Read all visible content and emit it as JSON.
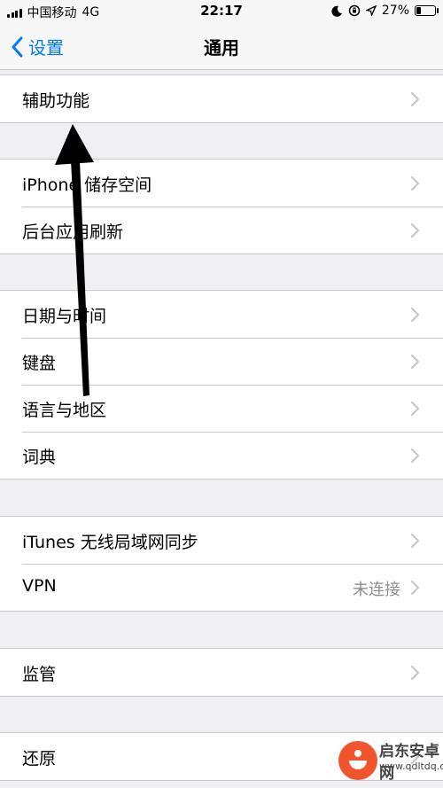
{
  "status_bar": {
    "carrier": "中国移动",
    "network": "4G",
    "time": "22:17",
    "battery": "27%",
    "battery_level": 0.27
  },
  "nav": {
    "back_label": "设置",
    "title": "通用"
  },
  "groups": [
    {
      "items": [
        {
          "label": "辅助功能"
        }
      ]
    },
    {
      "items": [
        {
          "label": "iPhone 储存空间"
        },
        {
          "label": "后台应用刷新"
        }
      ]
    },
    {
      "items": [
        {
          "label": "日期与时间"
        },
        {
          "label": "键盘"
        },
        {
          "label": "语言与地区"
        },
        {
          "label": "词典"
        }
      ]
    },
    {
      "items": [
        {
          "label": "iTunes 无线局域网同步"
        },
        {
          "label": "VPN",
          "value": "未连接"
        }
      ]
    },
    {
      "items": [
        {
          "label": "监管"
        }
      ]
    },
    {
      "items": [
        {
          "label": "还原"
        }
      ]
    }
  ],
  "watermark": {
    "name": "启东安卓网",
    "url": "www.qdltdq.com"
  },
  "colors": {
    "accent": "#007aff",
    "background": "#efeff4",
    "separator": "#c8c7cc"
  }
}
